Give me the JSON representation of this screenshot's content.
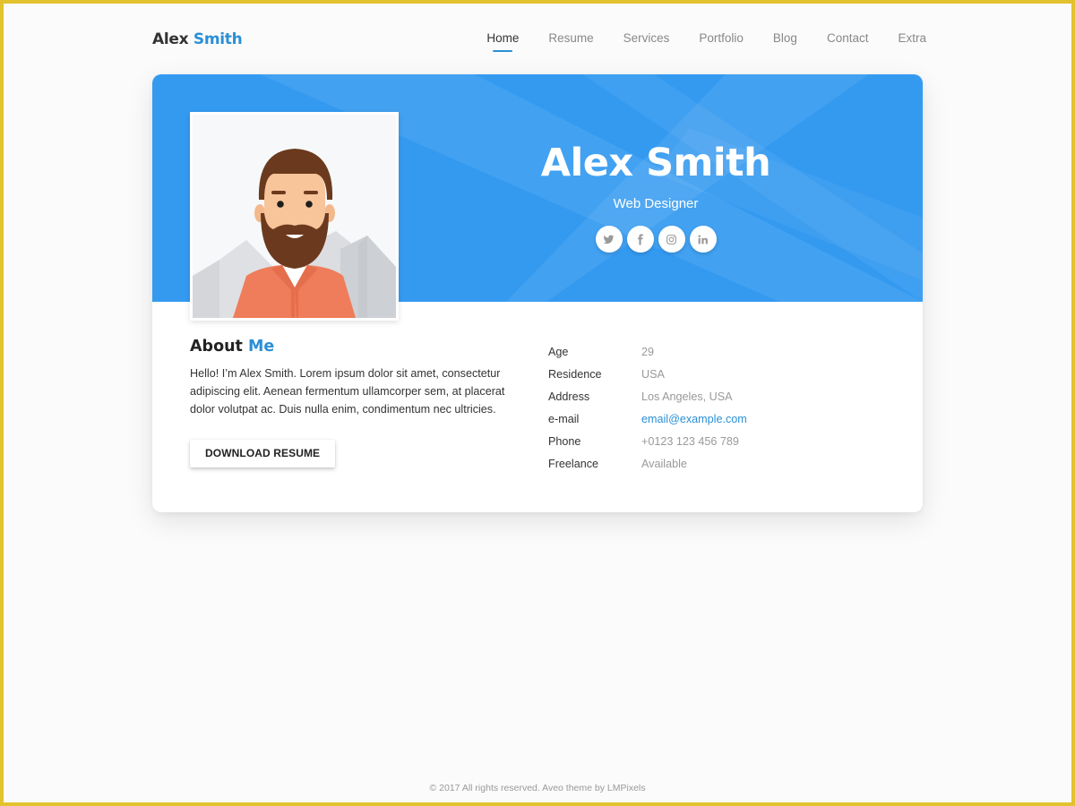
{
  "header": {
    "logo_first": "Alex",
    "logo_last": "Smith",
    "nav": [
      {
        "label": "Home",
        "active": true
      },
      {
        "label": "Resume",
        "active": false
      },
      {
        "label": "Services",
        "active": false
      },
      {
        "label": "Portfolio",
        "active": false
      },
      {
        "label": "Blog",
        "active": false
      },
      {
        "label": "Contact",
        "active": false
      },
      {
        "label": "Extra",
        "active": false
      }
    ]
  },
  "hero": {
    "name": "Alex Smith",
    "role": "Web Designer",
    "socials": [
      {
        "name": "twitter",
        "icon": "twitter-icon"
      },
      {
        "name": "facebook",
        "icon": "facebook-icon"
      },
      {
        "name": "instagram",
        "icon": "instagram-icon"
      },
      {
        "name": "linkedin",
        "icon": "linkedin-icon"
      }
    ],
    "avatar_alt": "Illustrated bearded man avatar"
  },
  "about": {
    "title_first": "About",
    "title_accent": "Me",
    "text": "Hello! I’m Alex Smith. Lorem ipsum dolor sit amet, consectetur adipiscing elit. Aenean fermentum ullamcorper sem, at placerat dolor volutpat ac. Duis nulla enim, condimentum nec ultricies.",
    "download_label": "DOWNLOAD RESUME"
  },
  "info": [
    {
      "label": "Age",
      "value": "29"
    },
    {
      "label": "Residence",
      "value": "USA"
    },
    {
      "label": "Address",
      "value": "Los Angeles, USA"
    },
    {
      "label": "e-mail",
      "value": "email@example.com"
    },
    {
      "label": "Phone",
      "value": "+0123 123 456 789"
    },
    {
      "label": "Freelance",
      "value": "Available"
    }
  ],
  "footer": {
    "text": "© 2017 All rights reserved. Aveo theme by LMPixels"
  },
  "colors": {
    "accent": "#2b8fd6",
    "hero_bg": "#349af0",
    "frame": "#e2c22e"
  }
}
